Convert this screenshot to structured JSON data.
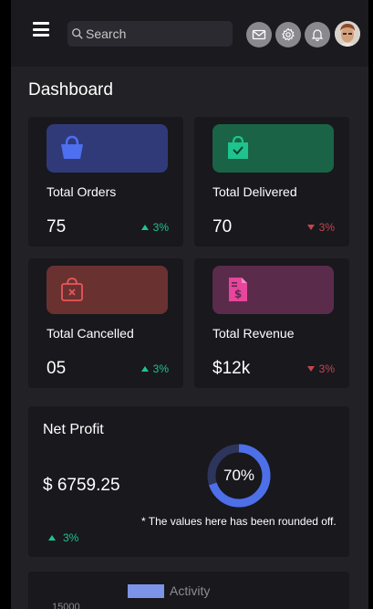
{
  "header": {
    "search_placeholder": "Search",
    "icons": [
      "menu-icon",
      "search-icon",
      "mail-icon",
      "gear-icon",
      "bell-icon"
    ]
  },
  "page": {
    "title": "Dashboard"
  },
  "cards": [
    {
      "label": "Total Orders",
      "value": "75",
      "trend": "3%",
      "direction": "up",
      "color": "#303a78",
      "icon": "basket-icon"
    },
    {
      "label": "Total Delivered",
      "value": "70",
      "trend": "3%",
      "direction": "down",
      "color": "#1b6346",
      "icon": "bag-check-icon"
    },
    {
      "label": "Total Cancelled",
      "value": "05",
      "trend": "3%",
      "direction": "up",
      "color": "#6a3131",
      "icon": "bag-x-icon"
    },
    {
      "label": "Total Revenue",
      "value": "$12k",
      "trend": "3%",
      "direction": "down",
      "color": "#5b2b4c",
      "icon": "invoice-dollar-icon"
    }
  ],
  "profit": {
    "title": "Net Profit",
    "amount": "$ 6759.25",
    "trend": "3%",
    "percent_label": "70%",
    "percent_value": 70,
    "note": "* The values here has been rounded off."
  },
  "activity": {
    "legend": "Activity",
    "first_tick": "15000"
  },
  "colors": {
    "accent": "#4d6fe8",
    "up": "#1ec38e",
    "down": "#c0464e"
  }
}
